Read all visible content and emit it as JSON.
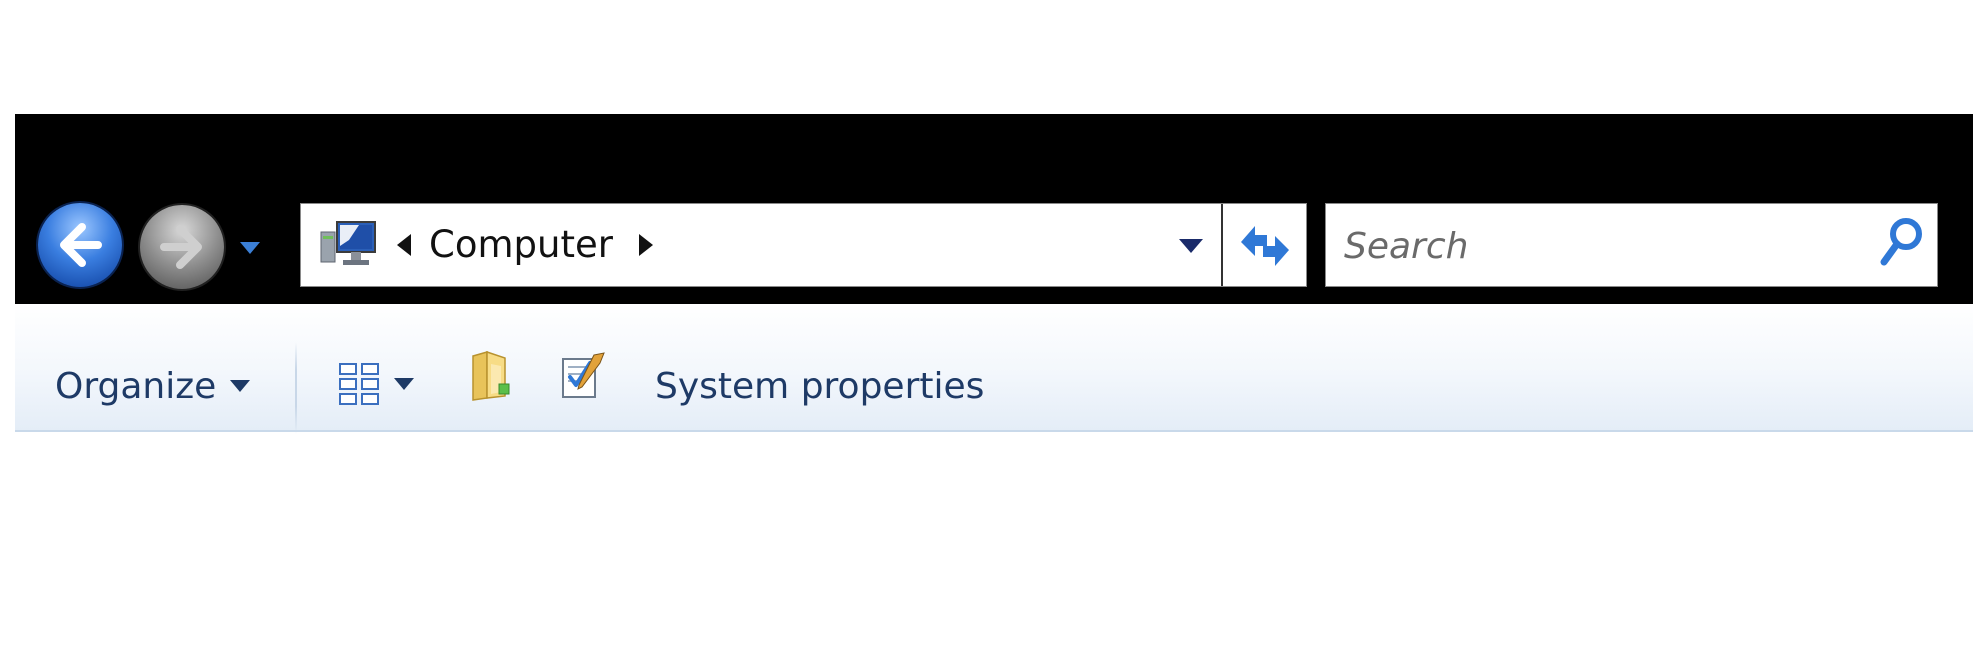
{
  "nav": {
    "back_icon": "back-arrow-icon",
    "forward_icon": "forward-arrow-icon",
    "recent_pages_icon": "chevron-down-icon"
  },
  "address_bar": {
    "location_icon": "computer-icon",
    "location": "Computer",
    "history_icon": "chevron-down-icon",
    "refresh_icon": "refresh-icon"
  },
  "search": {
    "placeholder": "Search",
    "value": "",
    "icon": "search-icon"
  },
  "toolbar": {
    "organize_label": "Organize",
    "views_icon": "views-icon",
    "new_folder_icon": "new-folder-icon",
    "properties_icon": "properties-icon",
    "system_properties_label": "System properties"
  },
  "colors": {
    "title_bar": "#000000",
    "toolbar_text": "#1e3a66",
    "toolbar_border": "#c9d9ea",
    "back_button": "#1c5fd0",
    "forward_button": "#8a8a8a",
    "accent_arrow": "#3b7fd6"
  }
}
